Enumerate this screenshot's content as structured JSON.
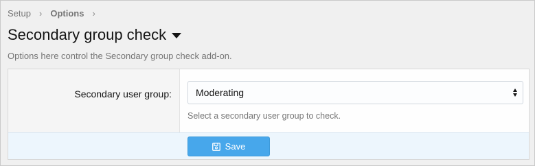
{
  "breadcrumb": {
    "items": [
      "Setup",
      "Options"
    ],
    "separator": "›"
  },
  "page": {
    "title": "Secondary group check",
    "description": "Options here control the Secondary group check add-on."
  },
  "form": {
    "row_label": "Secondary user group:",
    "select_value": "Moderating",
    "hint": "Select a secondary user group to check.",
    "save_label": "Save"
  },
  "icons": {
    "title_menu": "caret-down-icon",
    "select": "select-arrows-icon",
    "save": "floppy-disk-icon"
  },
  "colors": {
    "save_button": "#47a7eb",
    "footer_bg": "#edf6fd",
    "label_bg": "#f5f5f5"
  }
}
